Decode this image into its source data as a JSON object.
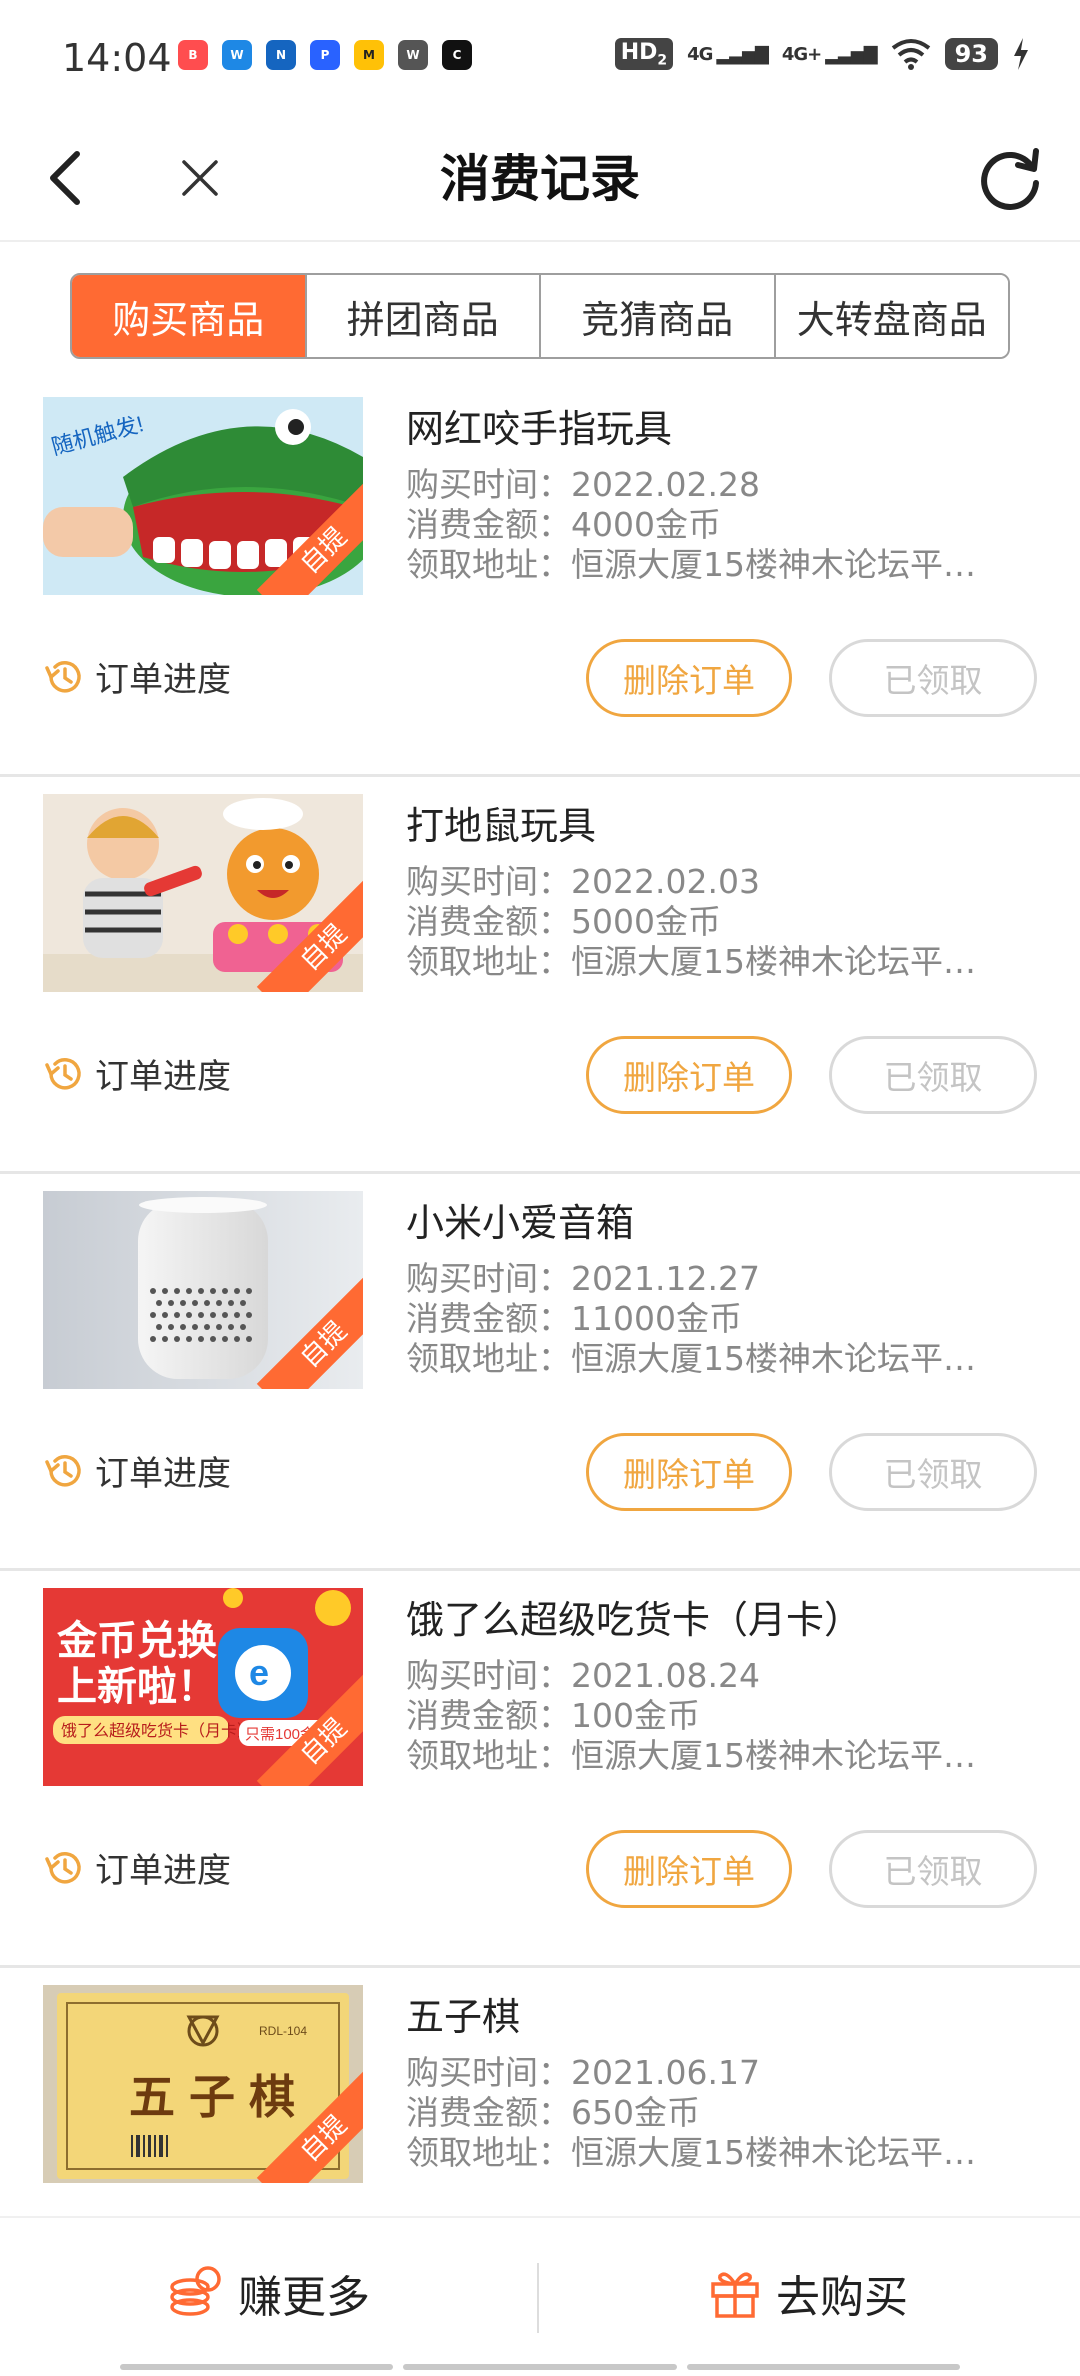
{
  "status": {
    "time": "14:04",
    "hd": "HD",
    "hd_sub": "2",
    "signal1": "4G",
    "signal2": "4G+",
    "battery": "93",
    "apps": [
      {
        "icon": "app-icon",
        "color": "#ff4d4f",
        "glyph": "B"
      },
      {
        "icon": "app-icon",
        "color": "#1e88e5",
        "glyph": "W"
      },
      {
        "icon": "app-icon",
        "color": "#1565c0",
        "glyph": "N"
      },
      {
        "icon": "app-icon",
        "color": "#2962ff",
        "glyph": "P"
      },
      {
        "icon": "app-icon",
        "color": "#ffc107",
        "glyph": "M"
      },
      {
        "icon": "wechat-icon",
        "color": "#555555",
        "glyph": "W"
      },
      {
        "icon": "app-icon",
        "color": "#111111",
        "glyph": "C"
      }
    ]
  },
  "nav": {
    "title": "消费记录",
    "back_icon": "back-arrow-icon",
    "close_icon": "close-icon",
    "refresh_icon": "refresh-icon"
  },
  "tabs": [
    {
      "label": "购买商品",
      "active": true
    },
    {
      "label": "拼团商品",
      "active": false
    },
    {
      "label": "竞猜商品",
      "active": false
    },
    {
      "label": "大转盘商品",
      "active": false
    }
  ],
  "labels": {
    "buy_time": "购买时间：",
    "amount": "消费金额：",
    "address": "领取地址：",
    "progress": "订单进度",
    "delete": "删除订单",
    "received": "已领取",
    "ribbon": "自提"
  },
  "orders": [
    {
      "title": "网红咬手指玩具",
      "date": "2022.02.28",
      "amount": "4000金币",
      "address": "恒源大厦15楼神木论坛平…"
    },
    {
      "title": "打地鼠玩具",
      "date": "2022.02.03",
      "amount": "5000金币",
      "address": "恒源大厦15楼神木论坛平…"
    },
    {
      "title": "小米小爱音箱",
      "date": "2021.12.27",
      "amount": "11000金币",
      "address": "恒源大厦15楼神木论坛平…"
    },
    {
      "title": "饿了么超级吃货卡（月卡）",
      "date": "2021.08.24",
      "amount": "100金币",
      "address": "恒源大厦15楼神木论坛平…"
    },
    {
      "title": "五子棋",
      "date": "2021.06.17",
      "amount": "650金币",
      "address": "恒源大厦15楼神木论坛平…"
    }
  ],
  "thumb_text": {
    "ad_line1": "金币兑换",
    "ad_line2": "上新啦！",
    "ad_line3": "饿了么超级吃货卡（月卡）",
    "ad_price": "只需100金币",
    "toy_tag": "随机触发!",
    "gomoku_text": "五子棋",
    "gomoku_code": "RDL-104"
  },
  "bottom": {
    "earn": "赚更多",
    "buy": "去购买"
  },
  "colors": {
    "accent": "#ff6a33",
    "button_orange": "#f0a640",
    "muted": "#888888"
  }
}
